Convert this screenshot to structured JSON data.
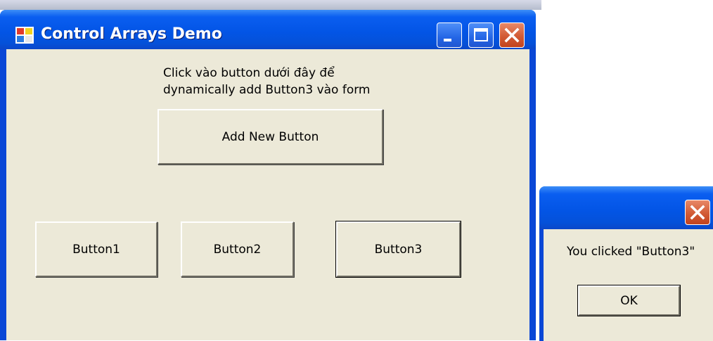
{
  "main_window": {
    "title": "Control Arrays Demo",
    "instruction_line1": "Click vào button dưới đây để",
    "instruction_line2": "dynamically add Button3 vào form",
    "add_button_label": "Add New Button",
    "buttons": [
      {
        "label": "Button1"
      },
      {
        "label": "Button2"
      },
      {
        "label": "Button3"
      }
    ]
  },
  "message_box": {
    "text": "You clicked \"Button3\"",
    "ok_label": "OK"
  },
  "colors": {
    "titlebar": "#0355e6",
    "client": "#ece9d8",
    "close_button": "#d25b35"
  }
}
